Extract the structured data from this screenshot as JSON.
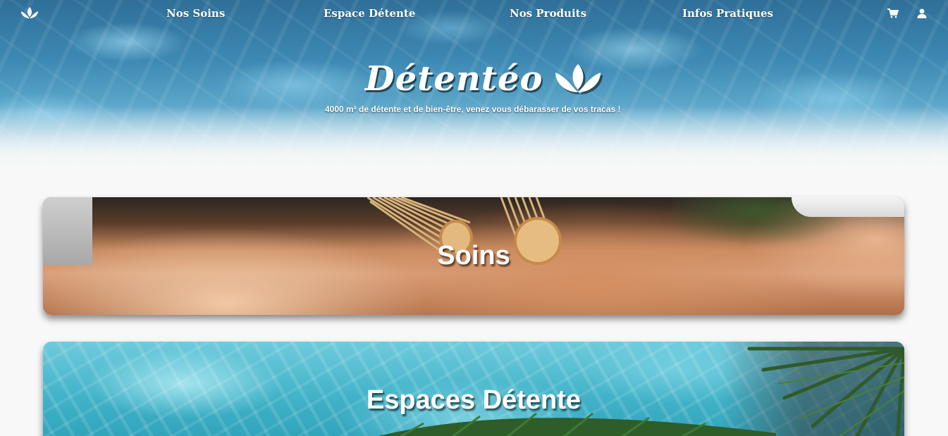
{
  "nav": {
    "logo_icon": "lotus-icon",
    "links": [
      "Nos Soins",
      "Espace Détente",
      "Nos Produits",
      "Infos Pratiques"
    ],
    "cart_icon": "cart-icon",
    "user_icon": "user-icon"
  },
  "hero": {
    "brand": "Détentéo",
    "brand_icon": "lotus-icon",
    "tagline": "4000 m² de détente et de bien-être, venez vous débarasser de vos tracas !"
  },
  "cards": [
    {
      "title": "Soins"
    },
    {
      "title": "Espaces Détente"
    }
  ],
  "colors": {
    "text_on_image": "#ffffff",
    "page_background": "#f8f8f8",
    "water_blue": "#3d89b3",
    "pool_turquoise": "#41b2c8"
  }
}
